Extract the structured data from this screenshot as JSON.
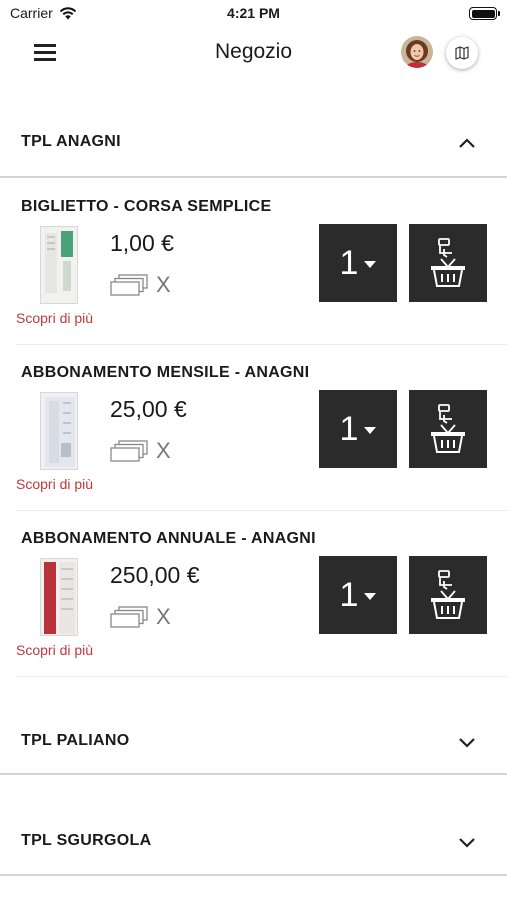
{
  "status_bar": {
    "carrier": "Carrier",
    "time": "4:21 PM"
  },
  "nav": {
    "title": "Negozio",
    "menu_icon": "hamburger-icon",
    "map_icon": "map-icon"
  },
  "sections": [
    {
      "title": "TPL ANAGNI",
      "expanded": true,
      "products": [
        {
          "name": "BIGLIETTO - CORSA SEMPLICE",
          "price": "1,00 €",
          "qty_label": "X",
          "more": "Scopri di più",
          "selected_qty": "1"
        },
        {
          "name": "ABBONAMENTO MENSILE - ANAGNI",
          "price": "25,00 €",
          "qty_label": "X",
          "more": "Scopri di più",
          "selected_qty": "1"
        },
        {
          "name": "ABBONAMENTO ANNUALE - ANAGNI",
          "price": "250,00 €",
          "qty_label": "X",
          "more": "Scopri di più",
          "selected_qty": "1"
        }
      ]
    },
    {
      "title": "TPL PALIANO",
      "expanded": false
    },
    {
      "title": "TPL SGURGOLA",
      "expanded": false
    }
  ],
  "colors": {
    "accent_red": "#c0393b",
    "button_dark": "#2b2b2b"
  }
}
